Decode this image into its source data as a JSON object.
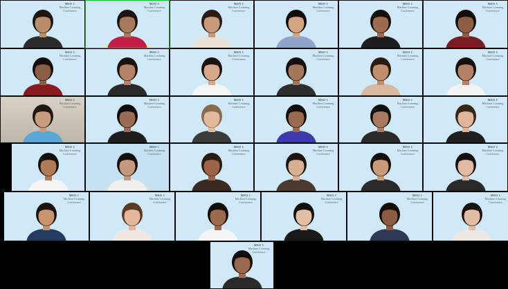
{
  "meeting": {
    "name": "zoom-gallery-view",
    "watermark": {
      "seal": "MSO 1",
      "line1": "Machine Learning",
      "line2": "Conference"
    },
    "colors": {
      "tile_bg": "#cfe9f8",
      "active_border": "#1fb141",
      "page_bg": "#000000"
    },
    "active_speaker_index": 1
  },
  "participants": [
    {
      "id": 1,
      "skin": "#b98c6a",
      "hair": "#1a1410",
      "shirt": "#2b2b2b"
    },
    {
      "id": 2,
      "skin": "#a87a5c",
      "hair": "#1c1410",
      "shirt": "#c21f45"
    },
    {
      "id": 3,
      "skin": "#c79a7c",
      "hair": "#2a1a12",
      "shirt": "#e8e2d6"
    },
    {
      "id": 4,
      "skin": "#d3a583",
      "hair": "#0f0d0c",
      "shirt": "#8fa3c9"
    },
    {
      "id": 5,
      "skin": "#9c6c4e",
      "hair": "#140f0c",
      "shirt": "#1d1d1d"
    },
    {
      "id": 6,
      "skin": "#8d5d45",
      "hair": "#120e0c",
      "shirt": "#7a1d22"
    },
    {
      "id": 7,
      "skin": "#8a5e44",
      "hair": "#130e0b",
      "shirt": "#8a1a1e"
    },
    {
      "id": 8,
      "skin": "#b48366",
      "hair": "#1a120e",
      "shirt": "#2a2a2a"
    },
    {
      "id": 9,
      "skin": "#d6a788",
      "hair": "#1b1310",
      "shirt": "#f4f4f4"
    },
    {
      "id": 10,
      "skin": "#a6765a",
      "hair": "#120e0c",
      "shirt": "#2e2e2e"
    },
    {
      "id": 11,
      "skin": "#c08d6d",
      "hair": "#2b1a12",
      "shirt": "#d9b8a0"
    },
    {
      "id": 12,
      "skin": "#b58166",
      "hair": "#151010",
      "shirt": "#f2f2f2"
    },
    {
      "id": 13,
      "skin": "#c89c7e",
      "hair": "#211712",
      "shirt": "#5aa6d6"
    },
    {
      "id": 14,
      "skin": "#9b6b52",
      "hair": "#120d0b",
      "shirt": "#1e1e1e"
    },
    {
      "id": 15,
      "skin": "#e1b99c",
      "hair": "#8a6a48",
      "shirt": "#3b3b3b"
    },
    {
      "id": 16,
      "skin": "#9a6a50",
      "hair": "#120e0b",
      "shirt": "#3e39a8"
    },
    {
      "id": 17,
      "skin": "#a87b60",
      "hair": "#130f0c",
      "shirt": "#2a2a2a"
    },
    {
      "id": 18,
      "skin": "#e0b59a",
      "hair": "#3a2614",
      "shirt": "#1f1f1f"
    },
    {
      "id": 19,
      "skin": "#b07a55",
      "hair": "#151010",
      "shirt": "#f5f5f5"
    },
    {
      "id": 20,
      "skin": "#c59a7c",
      "hair": "#141010",
      "shirt": "#f0f0f0"
    },
    {
      "id": 21,
      "skin": "#9d6548",
      "hair": "#2a1a10",
      "shirt": "#3a2a22"
    },
    {
      "id": 22,
      "skin": "#d7b092",
      "hair": "#1c1512",
      "shirt": "#4a3a30"
    },
    {
      "id": 23,
      "skin": "#c99b79",
      "hair": "#141010",
      "shirt": "#2b2b2b"
    },
    {
      "id": 24,
      "skin": "#e0bba0",
      "hair": "#151010",
      "shirt": "#2a2a2a"
    },
    {
      "id": 25,
      "skin": "#c8946f",
      "hair": "#1a120e",
      "shirt": "#223b5e"
    },
    {
      "id": 26,
      "skin": "#e2b79c",
      "hair": "#5a3a22",
      "shirt": "#f0e8e0"
    },
    {
      "id": 27,
      "skin": "#9c6a4d",
      "hair": "#120d0b",
      "shirt": "#f5f5f5"
    },
    {
      "id": 28,
      "skin": "#e3bea2",
      "hair": "#120e0c",
      "shirt": "#1a1a1a"
    },
    {
      "id": 29,
      "skin": "#8c5c42",
      "hair": "#120e0b",
      "shirt": "#2e3a55"
    },
    {
      "id": 30,
      "skin": "#e2bda4",
      "hair": "#1a1311",
      "shirt": "#ece7e2"
    },
    {
      "id": 31,
      "skin": "#9b6a4e",
      "hair": "#120d0b",
      "shirt": "#2a2a2a"
    }
  ]
}
